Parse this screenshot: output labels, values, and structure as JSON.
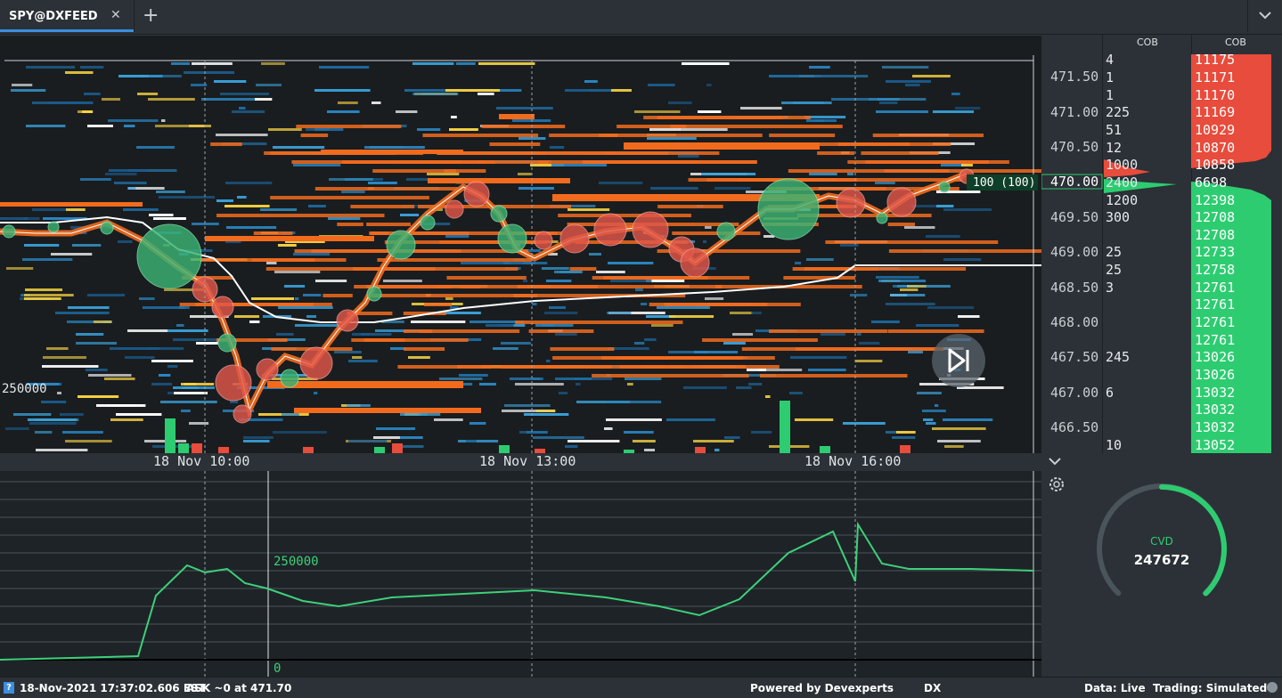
{
  "tab": {
    "title": "SPY@DXFEED",
    "close_icon": "close-icon",
    "add_icon": "plus-icon"
  },
  "header_right": {
    "icon": "chevron-down-icon"
  },
  "ladder": {
    "col_headers": [
      "COB",
      "COB"
    ],
    "prices": [
      "471.50",
      "471.00",
      "470.50",
      "470.00",
      "469.50",
      "469.00",
      "468.50",
      "468.00",
      "467.50",
      "467.00",
      "466.50"
    ],
    "left_qty": [
      "4",
      "1",
      "1",
      "225",
      "51",
      "12",
      "1000",
      "2400",
      "1200",
      "300",
      "",
      "25",
      "25",
      "3",
      "",
      "",
      "",
      "245",
      "",
      "6",
      "",
      "",
      "10"
    ],
    "right_qty": [
      "11175",
      "11171",
      "11170",
      "11169",
      "10929",
      "10870",
      "10858",
      "6698",
      "12398",
      "12708",
      "12708",
      "12733",
      "12758",
      "12761",
      "12761",
      "12761",
      "12761",
      "13026",
      "13026",
      "13032",
      "13032",
      "13032",
      "13052"
    ],
    "current_marker": "100 (100)",
    "ask_color": "#e74c3c",
    "bid_color": "#2ecc71"
  },
  "chart_overlay": {
    "volume_scale_label": "250000",
    "play_icon": "skip-forward-icon"
  },
  "time_axis": {
    "labels": [
      "18 Nov 10:00",
      "18 Nov 13:00",
      "18 Nov 16:00"
    ]
  },
  "cvd_panel": {
    "scale_top": "250000",
    "scale_zero": "0",
    "settings_icon": "gear-icon",
    "collapse_icon": "chevron-down-icon"
  },
  "gauge": {
    "label": "CVD",
    "value": "247672",
    "fill_fraction": 0.45,
    "color": "#2ecc71"
  },
  "chart_data": {
    "type": "line",
    "title": "",
    "series": [
      {
        "name": "CVD",
        "values": [
          0,
          5000,
          10000,
          180000,
          265000,
          245000,
          255000,
          215000,
          200000,
          165000,
          150000,
          175000,
          185000,
          195000,
          175000,
          150000,
          125000,
          170000,
          300000,
          360000,
          220000,
          380000,
          270000,
          255000,
          255000,
          250000
        ]
      }
    ]
  },
  "status_bar": {
    "datetime": "18-Nov-2021 17:37:02.606 EST",
    "ask_info": "ASK ~0 at 471.70",
    "powered_by": "Powered by Devexperts",
    "source": "DX",
    "data_mode": "Data: Live",
    "trading_mode": "Trading: Simulated",
    "help_icon": "help-icon"
  }
}
